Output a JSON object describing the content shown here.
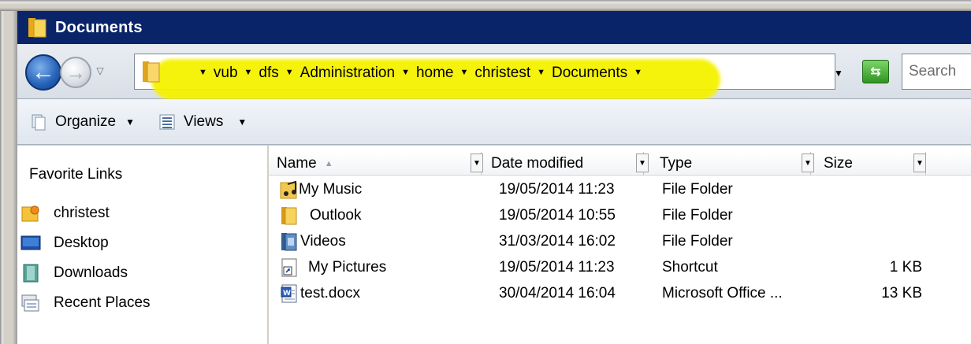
{
  "window": {
    "title": "Documents",
    "title_bar_color": "#0a246a",
    "folder_icon": "folder-icon"
  },
  "address_bar": {
    "breadcrumb": [
      "vub",
      "dfs",
      "Administration",
      "home",
      "christest",
      "Documents"
    ],
    "highlight_color": "#f5f200",
    "search_placeholder": "Search"
  },
  "toolbar": {
    "organize_label": "Organize",
    "views_label": "Views"
  },
  "favorites": {
    "title": "Favorite Links",
    "items": [
      {
        "label": "christest",
        "icon": "user-folder-icon"
      },
      {
        "label": "Desktop",
        "icon": "desktop-icon"
      },
      {
        "label": "Downloads",
        "icon": "downloads-icon"
      },
      {
        "label": "Recent Places",
        "icon": "recent-places-icon"
      }
    ]
  },
  "file_list": {
    "columns": [
      "Name",
      "Date modified",
      "Type",
      "Size"
    ],
    "sort_column": "Name",
    "rows": [
      {
        "name": "My Music",
        "date": "19/05/2014 11:23",
        "type": "File Folder",
        "size": "",
        "icon": "music-folder-icon"
      },
      {
        "name": "Outlook",
        "date": "19/05/2014 10:55",
        "type": "File Folder",
        "size": "",
        "icon": "folder-icon"
      },
      {
        "name": "Videos",
        "date": "31/03/2014 16:02",
        "type": "File Folder",
        "size": "",
        "icon": "videos-folder-icon"
      },
      {
        "name": "My Pictures",
        "date": "19/05/2014 11:23",
        "type": "Shortcut",
        "size": "1 KB",
        "icon": "shortcut-icon"
      },
      {
        "name": "test.docx",
        "date": "30/04/2014 16:04",
        "type": "Microsoft Office ...",
        "size": "13 KB",
        "icon": "word-document-icon"
      }
    ]
  }
}
